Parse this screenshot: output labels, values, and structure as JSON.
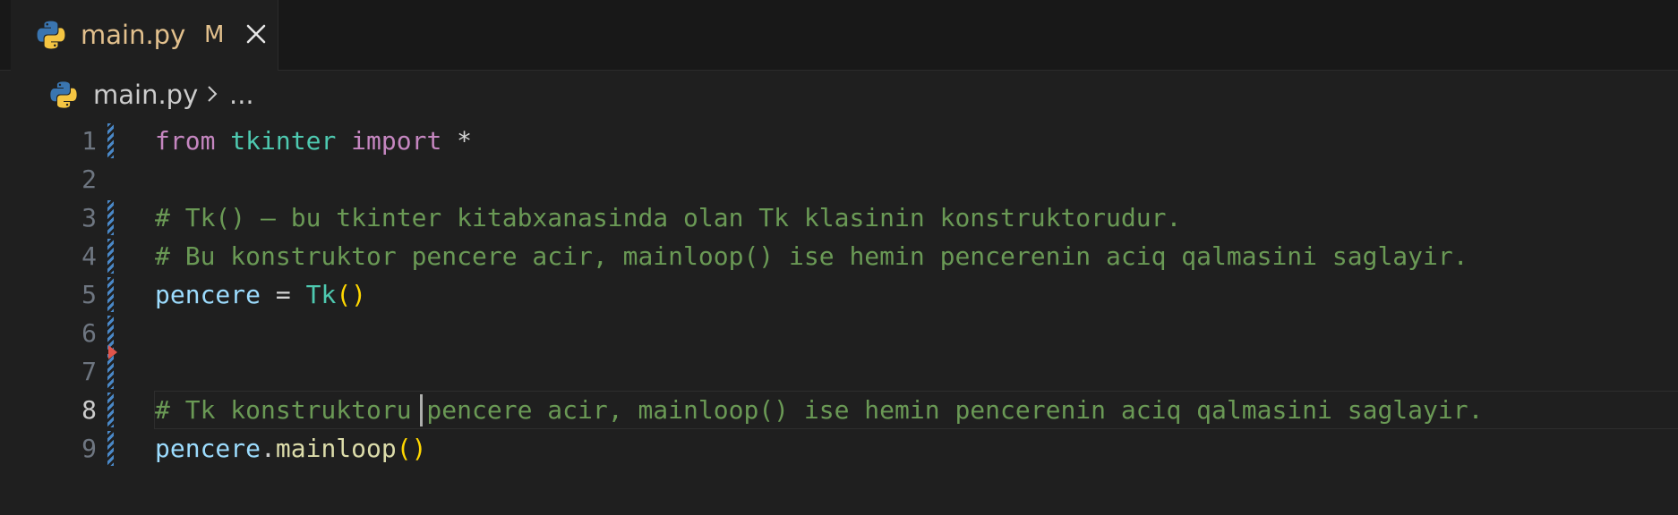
{
  "tab": {
    "label": "main.py",
    "badge": "M",
    "icon": "python-icon",
    "close_icon": "close-icon"
  },
  "breadcrumb": {
    "file": "main.py",
    "separator_icon": "chevron-right-icon",
    "more": "..."
  },
  "editor": {
    "active_line": 8,
    "lines": [
      {
        "number": "1",
        "tokens": [
          {
            "t": "from",
            "c": "k-kw"
          },
          {
            "t": " ",
            "c": "k-pun"
          },
          {
            "t": "tkinter",
            "c": "k-mod"
          },
          {
            "t": " ",
            "c": "k-pun"
          },
          {
            "t": "import",
            "c": "k-kw"
          },
          {
            "t": " *",
            "c": "k-op"
          }
        ],
        "modified": true
      },
      {
        "number": "2",
        "tokens": [],
        "modified": false
      },
      {
        "number": "3",
        "tokens": [
          {
            "t": "# Tk() – bu tkinter kitabxanasinda olan Tk klasinin konstruktorudur.",
            "c": "k-cm"
          }
        ],
        "modified": true
      },
      {
        "number": "4",
        "tokens": [
          {
            "t": "# Bu konstruktor pencere acir, mainloop() ise hemin pencerenin aciq qalmasini saglayir.",
            "c": "k-cm"
          }
        ],
        "modified": true
      },
      {
        "number": "5",
        "tokens": [
          {
            "t": "pencere",
            "c": "k-var"
          },
          {
            "t": " = ",
            "c": "k-op"
          },
          {
            "t": "Tk",
            "c": "k-cls"
          },
          {
            "t": "()",
            "c": "k-par"
          }
        ],
        "modified": true
      },
      {
        "number": "6",
        "tokens": [],
        "modified": true
      },
      {
        "number": "7",
        "tokens": [],
        "modified": true
      },
      {
        "number": "8",
        "tokens": [
          {
            "t": "# Tk konstruktoru pencere acir, mainloop() ise hemin pencerenin aciq qalmasini saglayir.",
            "c": "k-cm"
          }
        ],
        "modified": true
      },
      {
        "number": "9",
        "tokens": [
          {
            "t": "pencere",
            "c": "k-var"
          },
          {
            "t": ".",
            "c": "k-pun"
          },
          {
            "t": "mainloop",
            "c": "k-fn"
          },
          {
            "t": "()",
            "c": "k-par"
          }
        ],
        "modified": true
      }
    ]
  },
  "colors": {
    "background": "#1f1f1f",
    "tab_modified_text": "#e2c08d",
    "keyword": "#c586c0",
    "comment": "#6a9955",
    "variable": "#9cdcfe",
    "class": "#4ec9b0",
    "function": "#dcdcaa",
    "bracket": "#ffd700",
    "gutter_modified": "#4a88c7",
    "deleted_marker": "#e0554b"
  }
}
